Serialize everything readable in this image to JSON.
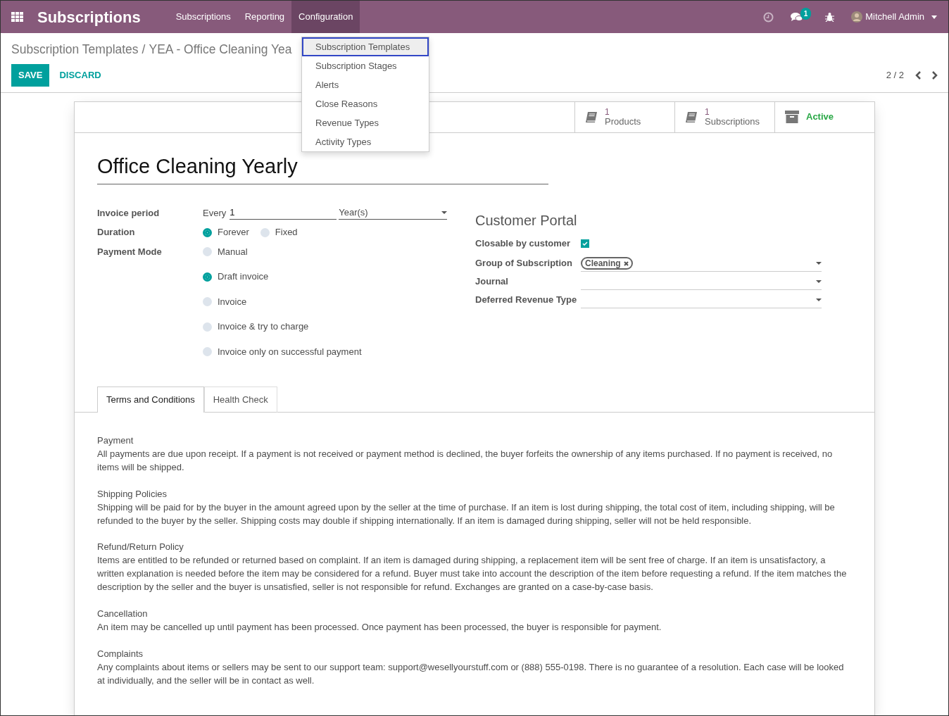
{
  "navbar": {
    "app_name": "Subscriptions",
    "menus": [
      {
        "label": "Subscriptions",
        "selected": false
      },
      {
        "label": "Reporting",
        "selected": false
      },
      {
        "label": "Configuration",
        "selected": true
      }
    ],
    "messages_badge": "1",
    "user_name": "Mitchell Admin"
  },
  "dropdown": {
    "items": [
      {
        "label": "Subscription Templates",
        "selected": true
      },
      {
        "label": "Subscription Stages",
        "selected": false
      },
      {
        "label": "Alerts",
        "selected": false
      },
      {
        "label": "Close Reasons",
        "selected": false
      },
      {
        "label": "Revenue Types",
        "selected": false
      },
      {
        "label": "Activity Types",
        "selected": false
      }
    ]
  },
  "breadcrumb": {
    "separator": "/",
    "items": [
      {
        "label": "Subscription Templates"
      },
      {
        "label": "YEA - Office Cleaning Yea"
      }
    ]
  },
  "actions": {
    "save": "SAVE",
    "discard": "DISCARD"
  },
  "pager": "2 / 2",
  "stat_buttons": [
    {
      "kind": "count",
      "value": "1",
      "label": "Products"
    },
    {
      "kind": "count",
      "value": "1",
      "label": "Subscriptions"
    },
    {
      "kind": "toggle",
      "label": "Active"
    }
  ],
  "title": "Office Cleaning Yearly",
  "invoice_period": {
    "label": "Invoice period",
    "prefix": "Every",
    "value": "1",
    "unit": "Year(s)"
  },
  "duration": {
    "label": "Duration",
    "options": [
      {
        "label": "Forever",
        "selected": true
      },
      {
        "label": "Fixed",
        "selected": false
      }
    ]
  },
  "payment_mode": {
    "label": "Payment Mode",
    "options": [
      {
        "label": "Manual",
        "selected": false
      },
      {
        "label": "Draft invoice",
        "selected": true
      },
      {
        "label": "Invoice",
        "selected": false
      },
      {
        "label": "Invoice & try to charge",
        "selected": false
      },
      {
        "label": "Invoice only on successful payment",
        "selected": false
      }
    ]
  },
  "customer_portal": {
    "heading": "Customer Portal",
    "closable": {
      "label": "Closable by customer",
      "checked": true
    },
    "fields": [
      {
        "label": "Group of Subscription",
        "tags": [
          "Cleaning"
        ]
      },
      {
        "label": "Journal"
      },
      {
        "label": "Deferred Revenue Type"
      }
    ]
  },
  "tabs": [
    {
      "label": "Terms and Conditions",
      "selected": true
    },
    {
      "label": "Health Check",
      "selected": false
    }
  ],
  "terms": [
    {
      "heading": "Payment",
      "text": "All payments are due upon receipt. If a payment is not received or payment method is declined, the buyer forfeits the ownership of any items purchased. If no payment is received, no items will be shipped."
    },
    {
      "heading": "Shipping Policies",
      "text": "Shipping will be paid for by the buyer in the amount agreed upon by the seller at the time of purchase. If an item is lost during shipping, the total cost of item, including shipping, will be refunded to the buyer by the seller. Shipping costs may double if shipping internationally. If an item is damaged during shipping, seller will not be held responsible."
    },
    {
      "heading": "Refund/Return Policy",
      "text": "Items are entitled to be refunded or returned based on complaint. If an item is damaged during shipping, a replacement item will be sent free of charge. If an item is unsatisfactory, a written explanation is needed before the item may be considered for a refund. Buyer must take into account the description of the item before requesting a refund. If the item matches the description by the seller and the buyer is unsatisfied, seller is not responsible for refund. Exchanges are granted on a case-by-case basis."
    },
    {
      "heading": "Cancellation",
      "text": "An item may be cancelled up until payment has been processed. Once payment has been processed, the buyer is responsible for payment."
    },
    {
      "heading": "Complaints",
      "text": "Any complaints about items or sellers may be sent to our support team: support@wesellyourstuff.com or (888) 555-0198. There is no guarantee of a resolution. Each case will be looked at individually, and the seller will be in contact as well."
    }
  ]
}
